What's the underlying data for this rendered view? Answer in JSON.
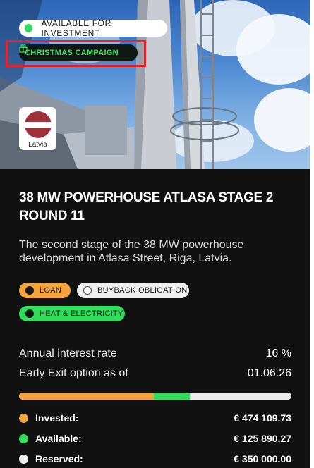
{
  "status_badge": {
    "label": "AVAILABLE FOR INVESTMENT",
    "color": "#2fdc5b"
  },
  "campaign_badge": {
    "label": "CHRISTMAS CAMPAIGN",
    "icon": "gift-icon",
    "color": "#37e667"
  },
  "country": {
    "name": "Latvia",
    "flag": "latvia-flag-icon"
  },
  "project": {
    "title": "38 MW POWERHOUSE ATLASA STAGE 2 ROUND 11",
    "description": "The second stage of the 38 MW powerhouse development in Atlasa Street, Riga, Latvia."
  },
  "tags": {
    "loan": {
      "label": "LOAN",
      "icon": "hand-coin-icon",
      "color": "#f4a43a"
    },
    "buyback": {
      "label": "BUYBACK OBLIGATION",
      "icon": "shield-icon",
      "color": "#ededed"
    },
    "heat": {
      "label": "HEAT & ELECTRICITY",
      "icon": "arrow-circle-icon",
      "color": "#2fdc5b"
    }
  },
  "details": {
    "rate_label": "Annual interest rate",
    "rate_value": "16 %",
    "exit_label": "Early Exit option as of",
    "exit_value": "01.06.26"
  },
  "funding": {
    "invested_fraction": 0.496,
    "available_fraction": 0.132,
    "invested": {
      "label": "Invested:",
      "amount": "€ 474 109.73",
      "color": "#f4a43a"
    },
    "available": {
      "label": "Available:",
      "amount": "€ 125 890.27",
      "color": "#2fdc5b"
    },
    "reserved": {
      "label": "Reserved:",
      "amount": "€ 350 000.00",
      "color": "#ececec"
    }
  }
}
